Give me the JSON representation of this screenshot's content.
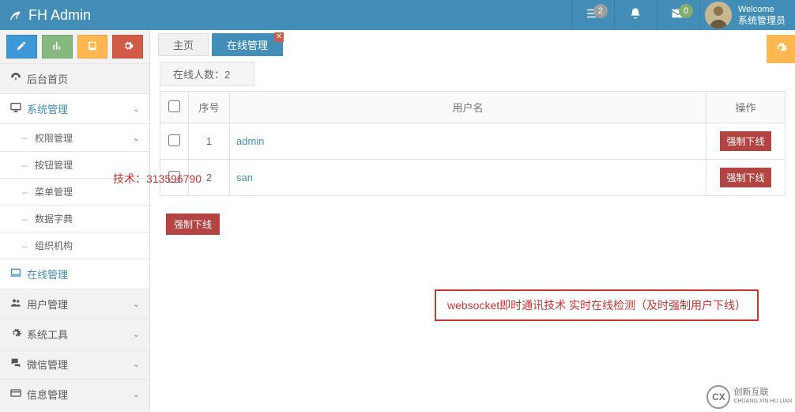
{
  "header": {
    "brand": "FH Admin",
    "list_badge": "2",
    "mail_badge": "0",
    "welcome": "Welcome",
    "role": "系统管理员"
  },
  "sidebar": {
    "item_home": "后台首页",
    "item_sys": "系统管理",
    "sub_perm": "权限管理",
    "sub_btn": "按钮管理",
    "sub_menu": "菜单管理",
    "sub_dict": "数据字典",
    "sub_org": "组织机构",
    "item_online": "在线管理",
    "item_user": "用户管理",
    "item_tools": "系统工具",
    "item_wechat": "微信管理",
    "item_info": "信息管理"
  },
  "tabs": {
    "home": "主页",
    "online": "在线管理"
  },
  "count": {
    "label": "在线人数：",
    "value": "2"
  },
  "table": {
    "h_seq": "序号",
    "h_user": "用户名",
    "h_act": "操作",
    "rows": [
      {
        "seq": "1",
        "user": "admin",
        "btn": "强制下线"
      },
      {
        "seq": "2",
        "user": "san",
        "btn": "强制下线"
      }
    ]
  },
  "overlay": {
    "tech": "技术：313596790",
    "btn_label": "强制下线",
    "callout": "websocket即时通讯技术    实时在线检测（及时强制用户下线）"
  },
  "watermark": {
    "circ": "CX",
    "line1": "创新互联",
    "line2": "CHUANG XIN HU LIAN"
  }
}
